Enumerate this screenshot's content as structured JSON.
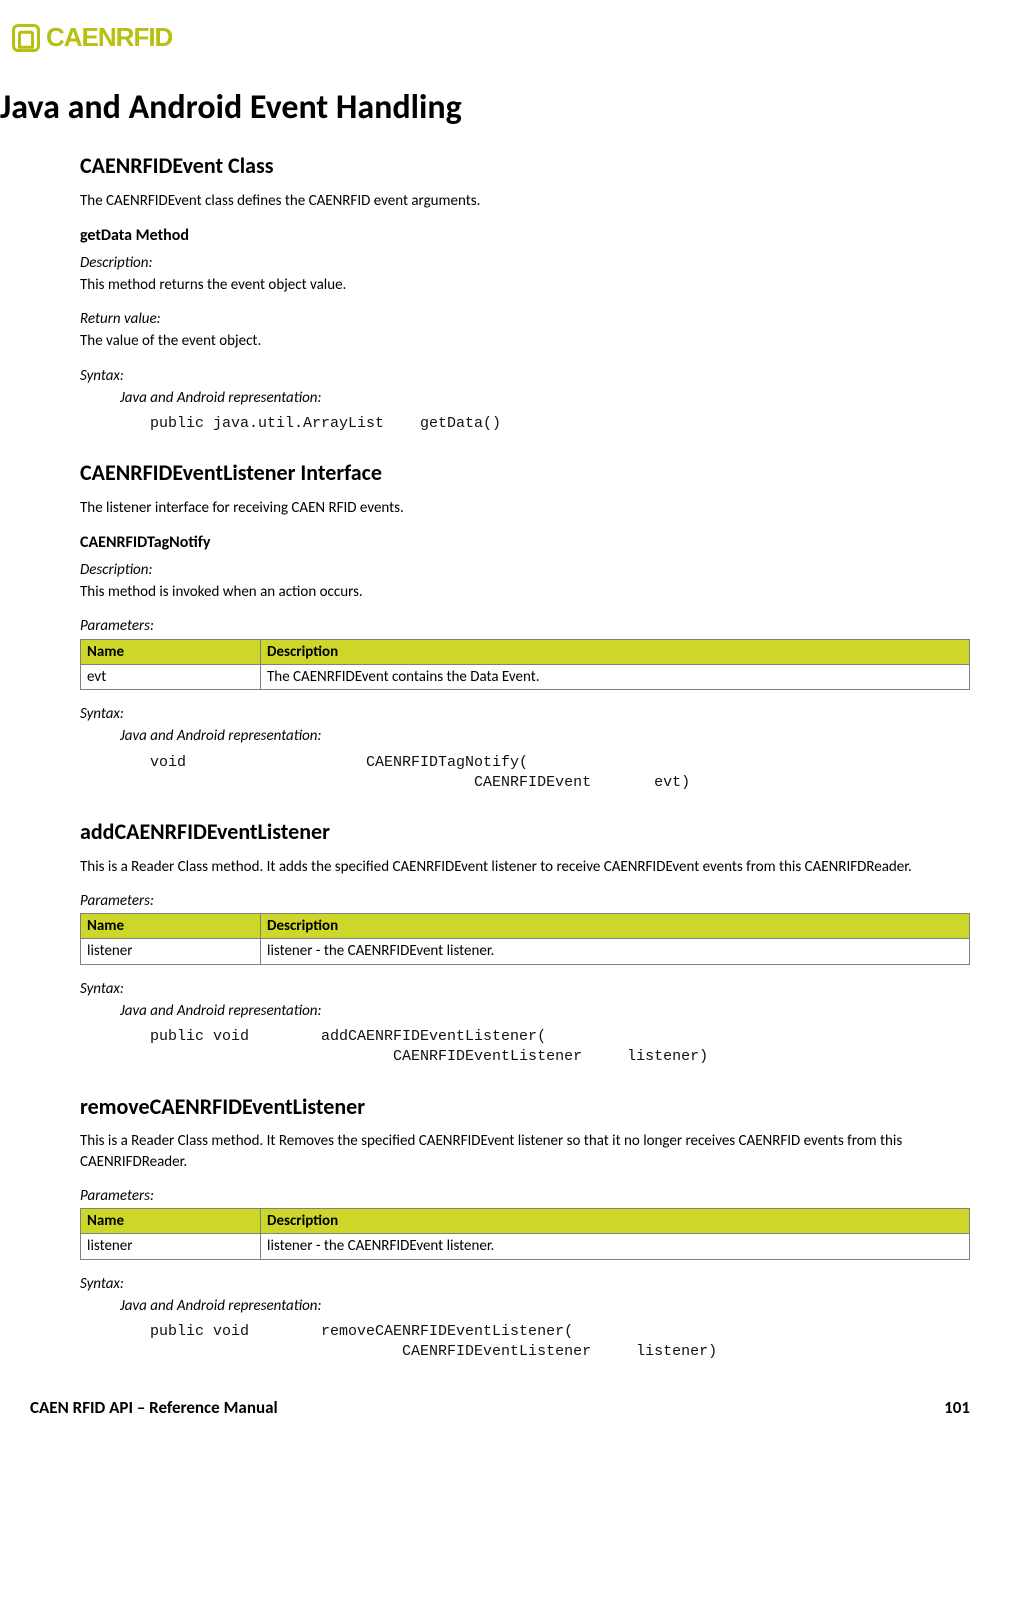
{
  "logo_text": "CAENRFID",
  "h1": "Java and Android Event Handling",
  "s1": {
    "title": "CAENRFIDEvent Class",
    "intro": "The CAENRFIDEvent class defines the CAENRFID event arguments.",
    "m1": {
      "name": "getData Method",
      "desc_label": "Description:",
      "desc": "This method returns the event object value.",
      "ret_label": "Return value:",
      "ret": "The value of the event object.",
      "syn_label": "Syntax:",
      "rep_label": "Java and Android representation:",
      "code": "public java.util.ArrayList    getData()"
    }
  },
  "s2": {
    "title": "CAENRFIDEventListener Interface",
    "intro": "The listener interface for receiving CAEN RFID events.",
    "m1": {
      "name": "CAENRFIDTagNotify",
      "desc_label": "Description:",
      "desc": "This method is invoked when an action occurs.",
      "params_label": "Parameters:",
      "th_name": "Name",
      "th_desc": "Description",
      "row_name": "evt",
      "row_desc": "The CAENRFIDEvent contains the Data Event.",
      "syn_label": "Syntax:",
      "rep_label": "Java and Android representation:",
      "code": "void                    CAENRFIDTagNotify(\n                                    CAENRFIDEvent       evt)"
    }
  },
  "s3": {
    "title": "addCAENRFIDEventListener",
    "intro": "This is a Reader Class method. It adds the specified CAENRFIDEvent listener to receive CAENRFIDEvent events from this CAENRIFDReader.",
    "params_label": "Parameters:",
    "th_name": "Name",
    "th_desc": "Description",
    "row_name": "listener",
    "row_desc": "listener - the CAENRFIDEvent listener.",
    "syn_label": "Syntax:",
    "rep_label": "Java and Android representation:",
    "code": "public void        addCAENRFIDEventListener(\n                           CAENRFIDEventListener     listener)"
  },
  "s4": {
    "title": "removeCAENRFIDEventListener",
    "intro": "This is a Reader Class method. It Removes the specified CAENRFIDEvent listener so that it no longer receives CAENRFID events from this CAENRIFDReader.",
    "params_label": "Parameters:",
    "th_name": "Name",
    "th_desc": "Description",
    "row_name": "listener",
    "row_desc": "listener - the CAENRFIDEvent listener.",
    "syn_label": "Syntax:",
    "rep_label": "Java and Android representation:",
    "code": "public void        removeCAENRFIDEventListener(\n                            CAENRFIDEventListener     listener)"
  },
  "footer": {
    "left": "CAEN RFID API – Reference Manual",
    "right": "101"
  }
}
